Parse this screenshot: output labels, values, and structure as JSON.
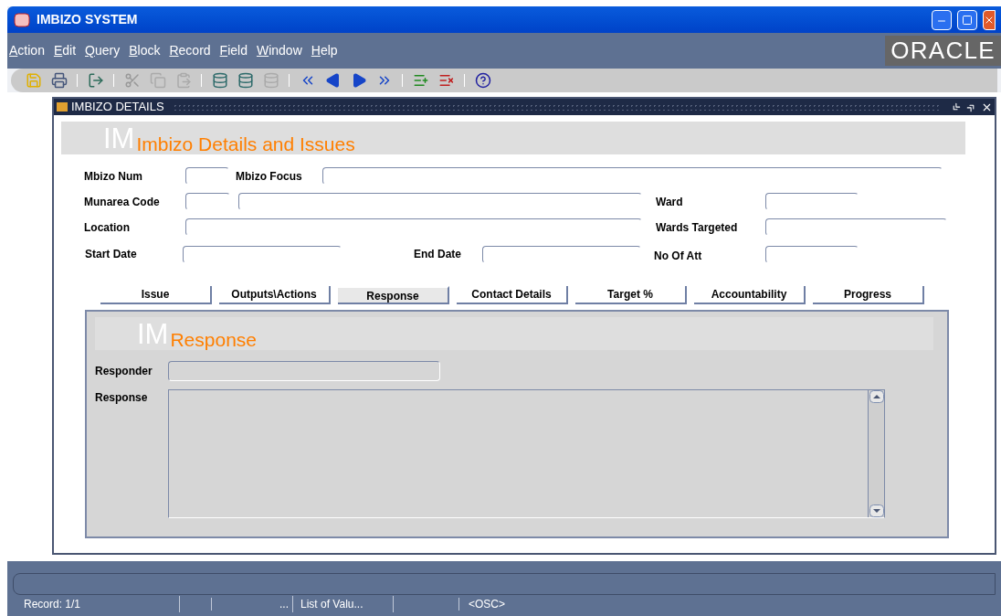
{
  "window": {
    "title": "IMBIZO SYSTEM"
  },
  "menu": [
    "Action",
    "Edit",
    "Query",
    "Block",
    "Record",
    "Field",
    "Window",
    "Help"
  ],
  "brand": "ORACLE",
  "form_window": {
    "title": "IMBIZO DETAILS",
    "banner": {
      "watermark": "IM",
      "title": "Imbizo Details and Issues"
    },
    "fields": [
      {
        "label": "Mbizo Num"
      },
      {
        "label": "Mbizo Focus"
      },
      {
        "label": "Munarea Code"
      },
      {
        "label": "Ward"
      },
      {
        "label": "Location"
      },
      {
        "label": "Wards Targeted"
      },
      {
        "label": "Start Date"
      },
      {
        "label": "End Date"
      },
      {
        "label": "No Of Att"
      }
    ],
    "tabs": [
      {
        "label": "Issue",
        "selected": false
      },
      {
        "label": "Outputs\\Actions",
        "selected": false
      },
      {
        "label": "Response",
        "selected": true
      },
      {
        "label": "Contact Details",
        "selected": false
      },
      {
        "label": "Target %",
        "selected": false
      },
      {
        "label": "Accountability",
        "selected": false
      },
      {
        "label": "Progress",
        "selected": false
      }
    ],
    "panel": {
      "banner": {
        "watermark": "IM",
        "title": "Response"
      },
      "fields": [
        {
          "label": "Responder"
        },
        {
          "label": "Response"
        }
      ]
    }
  },
  "status_bar": [
    "Record: 1/1",
    "...",
    "List of Valu...",
    "<OSC>"
  ]
}
